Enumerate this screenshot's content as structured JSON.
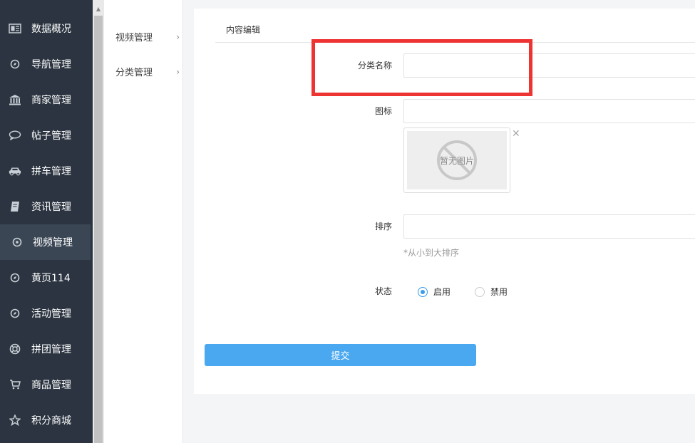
{
  "sidebar": {
    "items": [
      {
        "label": "数据概况",
        "icon": "dashboard-icon"
      },
      {
        "label": "导航管理",
        "icon": "compass-icon"
      },
      {
        "label": "商家管理",
        "icon": "bank-icon"
      },
      {
        "label": "帖子管理",
        "icon": "chat-bubble-icon"
      },
      {
        "label": "拼车管理",
        "icon": "car-icon"
      },
      {
        "label": "资讯管理",
        "icon": "book-icon"
      },
      {
        "label": "视频管理",
        "icon": "compass-icon"
      },
      {
        "label": "黄页114",
        "icon": "compass-icon"
      },
      {
        "label": "活动管理",
        "icon": "compass-icon"
      },
      {
        "label": "拼团管理",
        "icon": "lifebuoy-icon"
      },
      {
        "label": "商品管理",
        "icon": "cart-icon"
      },
      {
        "label": "积分商城",
        "icon": "star-icon"
      }
    ],
    "active_index": 6
  },
  "submenu": {
    "items": [
      {
        "label": "视频管理",
        "arrow": "›"
      },
      {
        "label": "分类管理",
        "arrow": "›"
      }
    ]
  },
  "panel": {
    "tab_title": "内容编辑",
    "form": {
      "category_name_label": "分类名称",
      "category_name_value": "",
      "icon_label": "图标",
      "icon_value": "",
      "no_image_text": "暂无图片",
      "close_glyph": "✕",
      "sort_label": "排序",
      "sort_value": "",
      "sort_hint": "*从小到大排序",
      "status_label": "状态",
      "status_options": [
        {
          "label": "启用",
          "selected": true
        },
        {
          "label": "禁用",
          "selected": false
        }
      ],
      "submit_label": "提交"
    }
  },
  "colors": {
    "sidebar_bg": "#2b3440",
    "sidebar_active": "#3a4654",
    "primary": "#4aa8f0",
    "highlight": "#ee3333"
  }
}
